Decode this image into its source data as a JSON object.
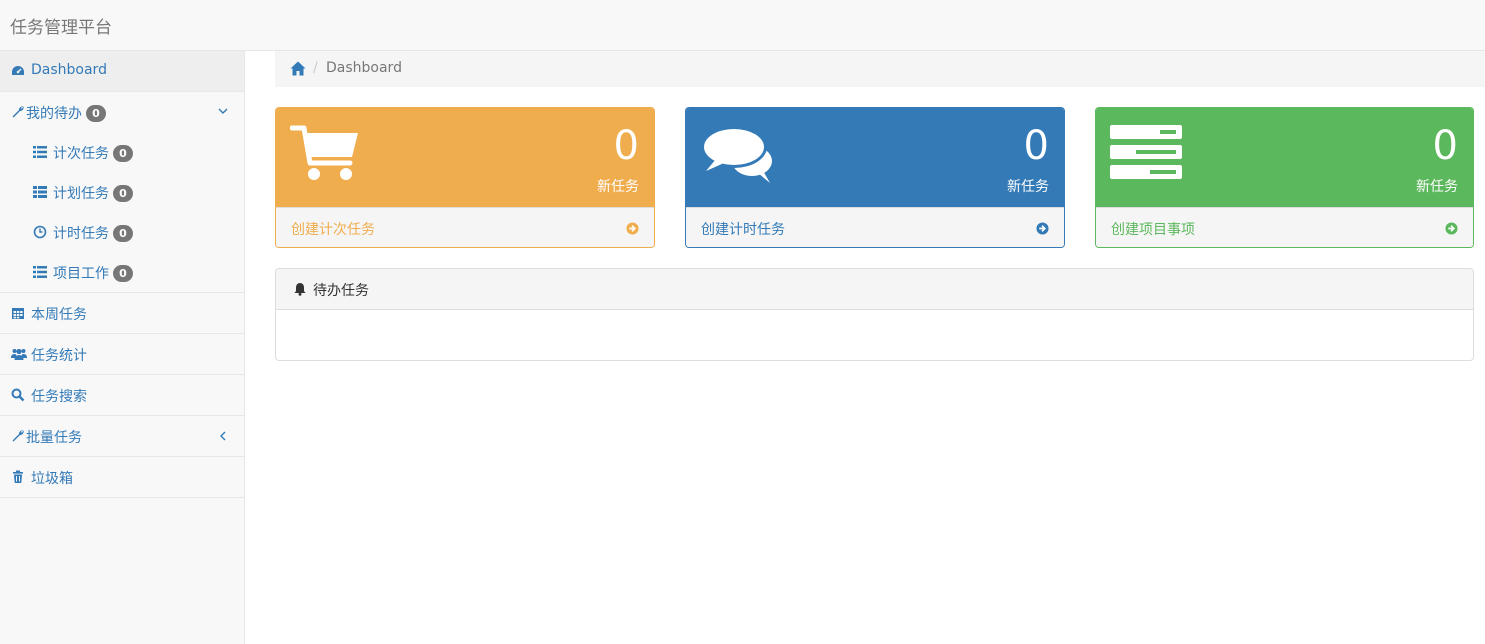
{
  "app": {
    "title": "任务管理平台"
  },
  "sidebar": {
    "dashboard": {
      "label": "Dashboard",
      "icon": "dashboard-icon"
    },
    "my_todo": {
      "label": "我的待办",
      "count": "0",
      "icon": "wrench-icon",
      "expanded": true,
      "children": [
        {
          "label": "计次任务",
          "count": "0",
          "icon": "list-icon"
        },
        {
          "label": "计划任务",
          "count": "0",
          "icon": "table-list-icon"
        },
        {
          "label": "计时任务",
          "count": "0",
          "icon": "clock-icon"
        },
        {
          "label": "项目工作",
          "count": "0",
          "icon": "list-icon"
        }
      ]
    },
    "weekly": {
      "label": "本周任务",
      "icon": "calendar-icon"
    },
    "stats": {
      "label": "任务统计",
      "icon": "users-icon"
    },
    "search": {
      "label": "任务搜索",
      "icon": "search-icon"
    },
    "batch": {
      "label": "批量任务",
      "icon": "wrench-icon",
      "expanded": false
    },
    "trash": {
      "label": "垃圾箱",
      "icon": "trash-icon"
    }
  },
  "breadcrumb": {
    "current": "Dashboard",
    "separator": "/"
  },
  "panels": [
    {
      "count": "0",
      "subtitle": "新任务",
      "link": "创建计次任务",
      "color": "#f0ad4e",
      "icon": "shopping-cart-icon"
    },
    {
      "count": "0",
      "subtitle": "新任务",
      "link": "创建计时任务",
      "color": "#337ab7",
      "icon": "comments-icon"
    },
    {
      "count": "0",
      "subtitle": "新任务",
      "link": "创建项目事项",
      "color": "#5cb85c",
      "icon": "tasks-icon"
    }
  ],
  "todo_panel": {
    "title": "待办任务",
    "icon": "bell-icon"
  }
}
